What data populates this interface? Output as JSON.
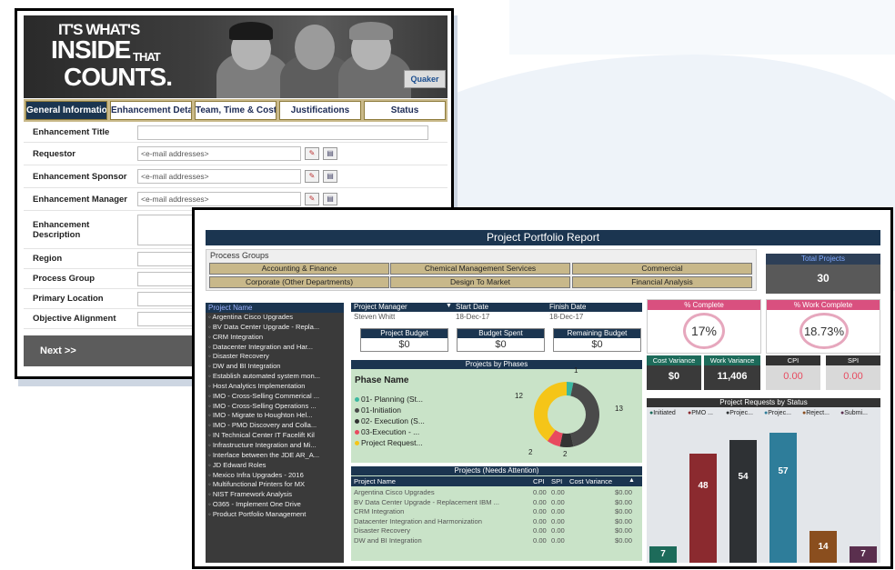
{
  "banner": {
    "line1": "IT'S WHAT'S",
    "line2": "INSIDE",
    "line2b": "THAT",
    "line3": "COUNTS.",
    "logo": "Quaker"
  },
  "form": {
    "tabs": [
      "General Information",
      "Enhancement Details",
      "Team, Time & Costs",
      "Justifications",
      "Status"
    ],
    "active_tab": 0,
    "fields": [
      {
        "label": "Enhancement Title",
        "value": "",
        "type": "text"
      },
      {
        "label": "Requestor",
        "value": "<e-mail addresses>",
        "type": "people"
      },
      {
        "label": "Enhancement Sponsor",
        "value": "<e-mail addresses>",
        "type": "people"
      },
      {
        "label": "Enhancement Manager",
        "value": "<e-mail addresses>",
        "type": "people"
      },
      {
        "label": "Enhancement Description",
        "value": "",
        "type": "textarea"
      },
      {
        "label": "Region",
        "value": "",
        "type": "select"
      },
      {
        "label": "Process Group",
        "value": "",
        "type": "select"
      },
      {
        "label": "Primary Location",
        "value": "",
        "type": "select"
      },
      {
        "label": "Objective Alignment",
        "value": "",
        "type": "select"
      }
    ],
    "next_label": "Next >>"
  },
  "dashboard": {
    "title": "Project Portfolio Report",
    "process_groups_label": "Process Groups",
    "process_groups": [
      [
        "Accounting & Finance",
        "Chemical Management Services",
        "Commercial"
      ],
      [
        "Corporate (Other Departments)",
        "Design To Market",
        "Financial Analysis"
      ]
    ],
    "total_projects": {
      "label": "Total Projects",
      "value": "30"
    },
    "project_list_header": "Project Name",
    "projects": [
      "Argentina Cisco Upgrades",
      "BV Data Center Upgrade - Repla...",
      "CRM Integration",
      "Datacenter Integration and Har...",
      "Disaster Recovery",
      "DW and BI Integration",
      "Establish automated system mon...",
      "Host Analytics Implementation",
      "IMO - Cross-Selling Commerical ...",
      "IMO - Cross-Selling Operations ...",
      "IMO - Migrate to Houghton Hel...",
      "IMO - PMO Discovery and Colla...",
      "IN Technical Center IT Facelift Kil",
      "Infrastructure Integration and Mi...",
      "Interface between the JDE AR_A...",
      "JD Edward Roles",
      "Mexico Infra Upgrades - 2016",
      "Multifunctional Printers for MX",
      "NIST Framework Analysis",
      "O365 - Implement One Drive",
      "Product Portfolio Management"
    ],
    "manager": {
      "h1": "Project Manager",
      "h2": "Start Date",
      "h3": "Finish Date",
      "name": "Steven Whitt",
      "start": "18-Dec-17",
      "finish": "18-Dec-17"
    },
    "budgets": [
      {
        "label": "Project Budget",
        "value": "$0"
      },
      {
        "label": "Budget Spent",
        "value": "$0"
      },
      {
        "label": "Remaining Budget",
        "value": "$0"
      }
    ],
    "phases_title": "Projects by Phases",
    "phase_name_label": "Phase Name",
    "phase_legend": [
      {
        "label": "01- Planning (St...",
        "color": "#3bb8a0"
      },
      {
        "label": "01-Initiation",
        "color": "#4a4a4a"
      },
      {
        "label": "02- Execution (S...",
        "color": "#333333"
      },
      {
        "label": "03-Execution - ...",
        "color": "#e84a5f"
      },
      {
        "label": "Project Request...",
        "color": "#f5c518"
      }
    ],
    "phase_labels": [
      "1",
      "12",
      "13",
      "2",
      "2"
    ],
    "attention_title": "Projects (Needs Attention)",
    "attention_cols": [
      "Project Name",
      "CPI",
      "SPI",
      "Cost Variance"
    ],
    "attention_rows": [
      [
        "Argentina Cisco Upgrades",
        "0.00",
        "0.00",
        "$0.00"
      ],
      [
        "BV Data Center Upgrade - Replacement IBM ...",
        "0.00",
        "0.00",
        "$0.00"
      ],
      [
        "CRM Integration",
        "0.00",
        "0.00",
        "$0.00"
      ],
      [
        "Datacenter Integration and Harmonization",
        "0.00",
        "0.00",
        "$0.00"
      ],
      [
        "Disaster Recovery",
        "0.00",
        "0.00",
        "$0.00"
      ],
      [
        "DW and BI Integration",
        "0.00",
        "0.00",
        "$0.00"
      ]
    ],
    "pct_complete": {
      "label": "% Complete",
      "value": "17%"
    },
    "work_complete": {
      "label": "% Work Complete",
      "value": "18.73%"
    },
    "cost_variance": {
      "label": "Cost Variance",
      "value": "$0"
    },
    "work_variance": {
      "label": "Work Variance",
      "value": "11,406"
    },
    "cpi": {
      "label": "CPI",
      "value": "0.00"
    },
    "spi": {
      "label": "SPI",
      "value": "0.00"
    },
    "requests_title": "Project Requests by Status",
    "request_legend": [
      "Initiated",
      "PMO ...",
      "Projec...",
      "Projec...",
      "Reject...",
      "Submi..."
    ],
    "request_values": [
      7,
      48,
      54,
      57,
      14,
      7
    ],
    "request_colors": [
      "#1d6b5a",
      "#8b2a2f",
      "#2e3134",
      "#2e7d9a",
      "#8a4e1e",
      "#5a2f4e"
    ]
  }
}
